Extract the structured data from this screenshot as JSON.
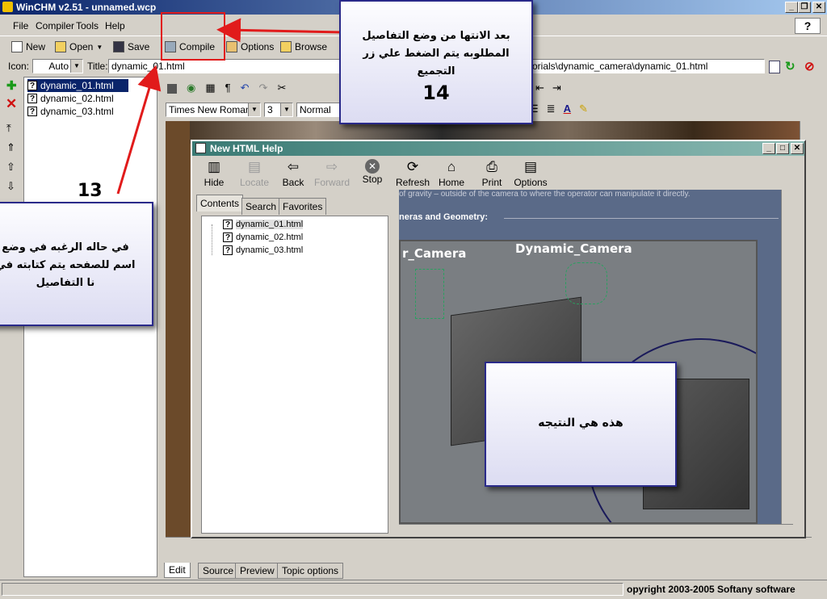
{
  "app": {
    "title": "WinCHM  v2.51 - unnamed.wcp"
  },
  "menu": [
    "File",
    "Compiler",
    "Tools",
    "Help"
  ],
  "toolbar": {
    "new": "New",
    "open": "Open",
    "save": "Save",
    "compile": "Compile",
    "options": "Options",
    "browse": "Browse"
  },
  "props": {
    "icon_label": "Icon:",
    "icon_value": "Auto",
    "title_label": "Title:",
    "title_value": "dynamic_01.html",
    "path_value": "orials\\dynamic_camera\\dynamic_01.html"
  },
  "files": [
    "dynamic_01.html",
    "dynamic_02.html",
    "dynamic_03.html"
  ],
  "format": {
    "font": "Times New Roman",
    "size": "3",
    "style": "Normal"
  },
  "bottom_tabs": [
    "Edit",
    "Source",
    "Preview",
    "Topic options"
  ],
  "status": {
    "copyright": "opyright 2003-2005 Softany software"
  },
  "help": {
    "title": "New HTML Help",
    "buttons": [
      "Hide",
      "Locate",
      "Back",
      "Forward",
      "Stop",
      "Refresh",
      "Home",
      "Print",
      "Options"
    ],
    "tabs": [
      "Contents",
      "Search",
      "Favorites"
    ],
    "toc": [
      "dynamic_01.html",
      "dynamic_02.html",
      "dynamic_03.html"
    ],
    "content_line": "of gravity – outside of the camera to where the operator can manipulate it directly.",
    "heading": "neras and Geometry:",
    "render_label_left": "r_Camera",
    "render_label_right": "Dynamic_Camera"
  },
  "annotations": {
    "step14_text": "بعد الانتها من وضع التفاصيل المطلوبه يتم الضغط علي زر التجميع",
    "step14_number": "14",
    "step13_text": "في حاله الرغبه في وضع اسم للصفحه يتم كتابته في نا التفاصيل",
    "step13_number": "13",
    "result_text": "هذه هي النتيجه"
  },
  "colors": {
    "title_active": "#0a246a",
    "help_title": "#3a7a74",
    "annotation_arrow": "#e11b1b",
    "highlight_box": "#e11b1b"
  }
}
